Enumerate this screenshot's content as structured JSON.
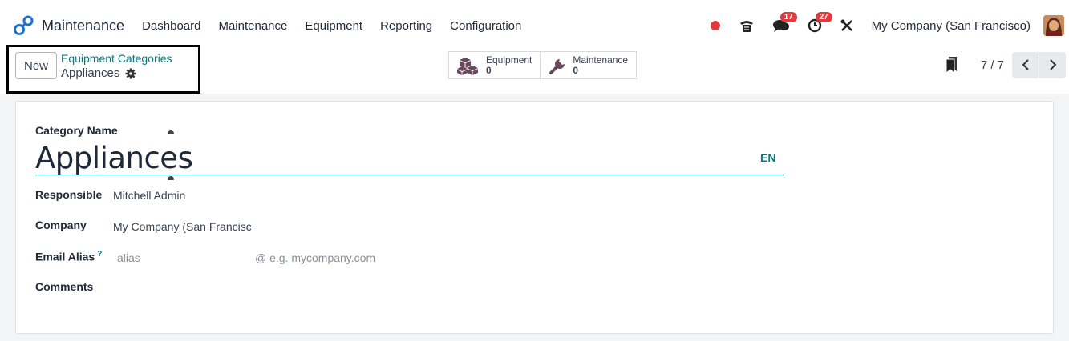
{
  "app": {
    "name": "Maintenance",
    "menu": [
      "Dashboard",
      "Maintenance",
      "Equipment",
      "Reporting",
      "Configuration"
    ],
    "brand_color": "#1f6fd1"
  },
  "systray": {
    "messages_count": "17",
    "activities_count": "27",
    "company": "My Company (San Francisco)"
  },
  "control_panel": {
    "new_label": "New",
    "breadcrumb_parent": "Equipment Categories",
    "breadcrumb_current": "Appliances",
    "smart_buttons": [
      {
        "label": "Equipment",
        "count": "0"
      },
      {
        "label": "Maintenance",
        "count": "0"
      }
    ],
    "pager": "7 / 7"
  },
  "form": {
    "category_name_label": "Category Name",
    "category_name_value": "Appliances",
    "lang": "EN",
    "responsible_label": "Responsible",
    "responsible_value": "Mitchell Admin",
    "company_label": "Company",
    "company_value": "My Company (San Francisc",
    "email_alias_label": "Email Alias",
    "email_alias_help": "?",
    "email_alias_placeholder": "alias",
    "email_domain_placeholder": "@ e.g. mycompany.com",
    "comments_label": "Comments"
  },
  "colors": {
    "accent": "#017e84",
    "badge": "#e03a3e",
    "recording_dot": "#e03a3e"
  }
}
